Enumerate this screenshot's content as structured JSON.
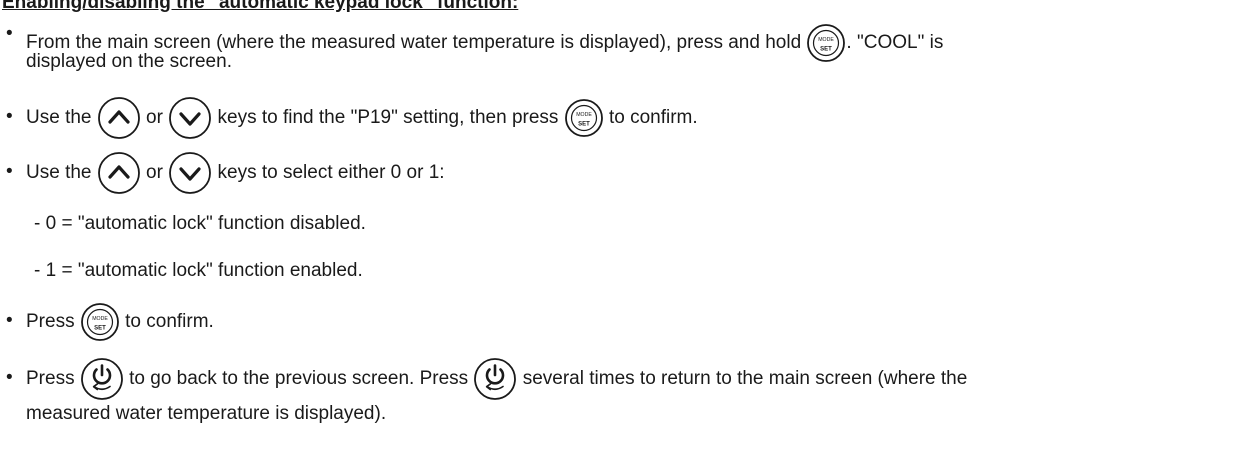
{
  "heading": "Enabling/disabling the \"automatic keypad lock\" function:",
  "bullet": "•",
  "icons": {
    "mode_set": {
      "top": "MODE",
      "bottom": "SET"
    },
    "up_arrow": "up-arrow-icon",
    "down_arrow": "down-arrow-icon",
    "power": "power-icon"
  },
  "items": [
    {
      "part1": "From the main screen (where the measured water temperature is displayed), press and hold ",
      "part2": ". \"COOL\" is",
      "part3": "displayed on the screen."
    },
    {
      "part1": "Use the ",
      "part2": " or ",
      "part3": " keys to find the \"P19\" setting, then press ",
      "part4": " to confirm."
    },
    {
      "part1": "Use the ",
      "part2": " or ",
      "part3": " keys to select either 0 or 1:"
    },
    {
      "sub1": "- 0 = \"automatic lock\" function disabled.",
      "sub2": "- 1 = \"automatic lock\" function enabled."
    },
    {
      "part1": "Press ",
      "part2": " to confirm."
    },
    {
      "part1": "Press ",
      "part2": " to go back to the previous screen. Press ",
      "part3": " several times to return to the main screen (where the",
      "part4": "measured water temperature is displayed)."
    }
  ]
}
